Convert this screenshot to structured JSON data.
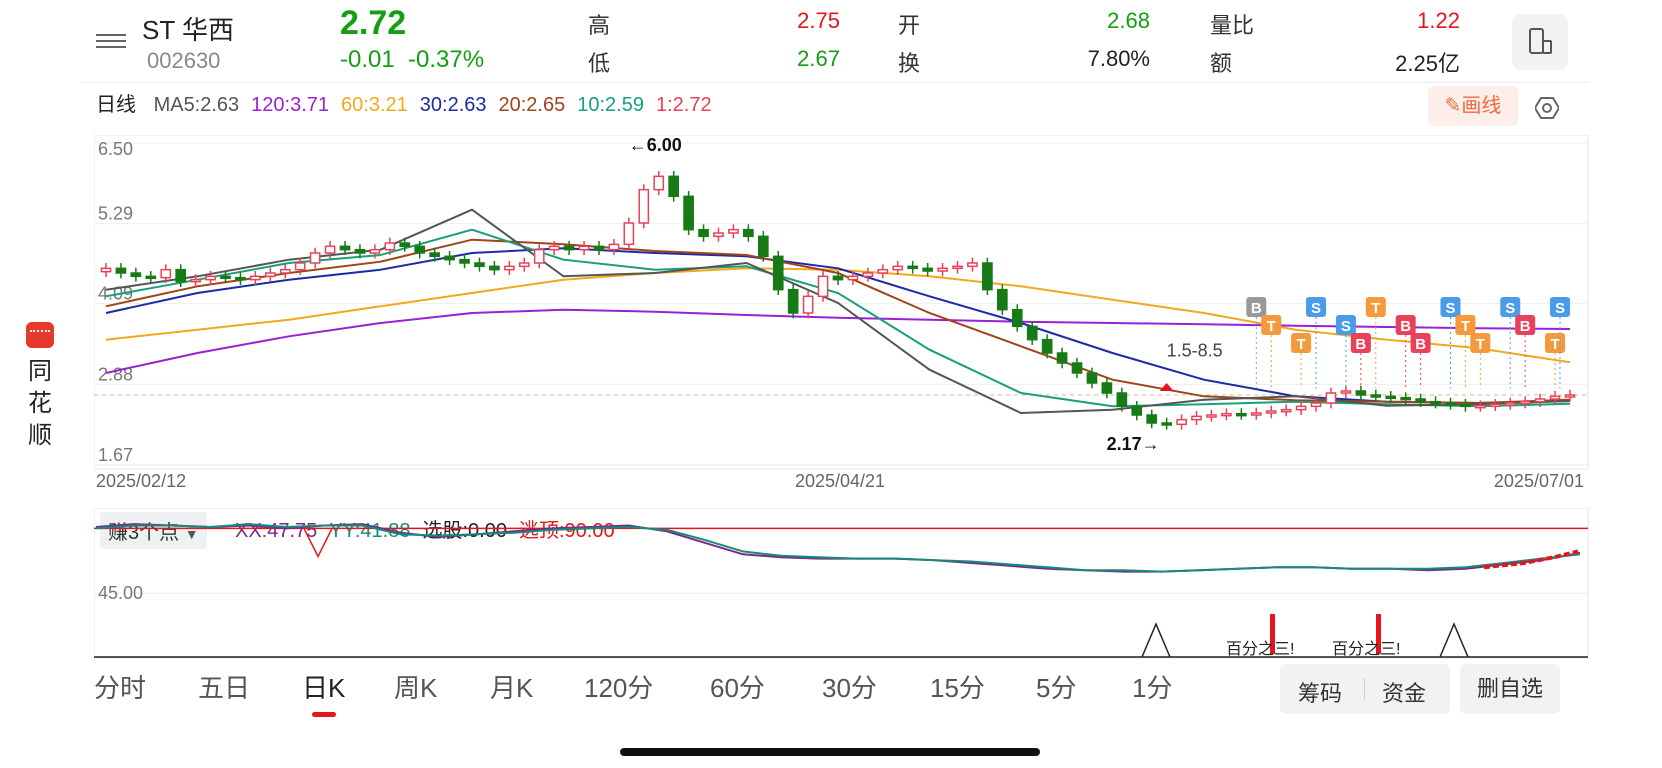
{
  "brand": {
    "name_chars": [
      "同",
      "花",
      "顺"
    ]
  },
  "quote": {
    "name": "ST 华西",
    "code": "002630",
    "price": "2.72",
    "change": "-0.01",
    "change_pct": "-0.37%",
    "stats": [
      {
        "label": "高",
        "value": "2.75",
        "color": "#e8141b"
      },
      {
        "label": "低",
        "value": "2.67",
        "color": "#12a012"
      },
      {
        "label": "开",
        "value": "2.68",
        "color": "#12a012"
      },
      {
        "label": "换",
        "value": "7.80%",
        "color": "#222222"
      },
      {
        "label": "量比",
        "value": "1.22",
        "color": "#e8141b"
      },
      {
        "label": "额",
        "value": "2.25亿",
        "color": "#222222"
      }
    ]
  },
  "ma_bar": {
    "period": "日线",
    "items": [
      {
        "text": "MA5:2.63",
        "color": "#555555"
      },
      {
        "text": "120:3.71",
        "color": "#9b1fd8"
      },
      {
        "text": "60:3.21",
        "color": "#f2a81d"
      },
      {
        "text": "30:2.63",
        "color": "#1c2aa6"
      },
      {
        "text": "20:2.65",
        "color": "#a0441a"
      },
      {
        "text": "10:2.59",
        "color": "#17a07a"
      },
      {
        "text": "1:2.72",
        "color": "#e8415a"
      }
    ],
    "draw_button": "画线"
  },
  "chart_data": {
    "type": "candlestick",
    "y_ticks": [
      "6.50",
      "5.29",
      "4.09",
      "2.88",
      "1.67"
    ],
    "ylim": [
      1.67,
      6.5
    ],
    "x_ticks": [
      "2025/02/12",
      "2025/04/21",
      "2025/07/01"
    ],
    "annotations": {
      "high": "←6.00",
      "low": "2.17→",
      "range": "1.5-8.5"
    },
    "close_approx": [
      4.62,
      4.55,
      4.5,
      4.48,
      4.6,
      4.42,
      4.45,
      4.5,
      4.48,
      4.45,
      4.5,
      4.55,
      4.6,
      4.7,
      4.85,
      4.95,
      4.9,
      4.85,
      4.9,
      5.0,
      4.95,
      4.85,
      4.8,
      4.75,
      4.7,
      4.65,
      4.6,
      4.65,
      4.7,
      4.9,
      4.95,
      4.9,
      4.95,
      4.9,
      4.98,
      5.3,
      5.8,
      6.0,
      5.7,
      5.2,
      5.1,
      5.15,
      5.2,
      5.1,
      4.8,
      4.3,
      3.95,
      4.2,
      4.5,
      4.45,
      4.5,
      4.55,
      4.6,
      4.65,
      4.62,
      4.58,
      4.62,
      4.65,
      4.7,
      4.3,
      4.0,
      3.75,
      3.55,
      3.35,
      3.2,
      3.05,
      2.9,
      2.75,
      2.55,
      2.42,
      2.3,
      2.28,
      2.35,
      2.4,
      2.42,
      2.44,
      2.43,
      2.45,
      2.48,
      2.5,
      2.55,
      2.6,
      2.75,
      2.78,
      2.72,
      2.7,
      2.68,
      2.66,
      2.62,
      2.6,
      2.58,
      2.55,
      2.56,
      2.58,
      2.6,
      2.62,
      2.66,
      2.7,
      2.72
    ],
    "ma_series": [
      {
        "name": "120",
        "color": "#9b1fd8",
        "values": [
          3.05,
          3.35,
          3.6,
          3.8,
          3.95,
          4.0,
          3.97,
          3.92,
          3.88,
          3.85,
          3.82,
          3.8,
          3.78,
          3.76,
          3.74,
          3.72,
          3.71
        ]
      },
      {
        "name": "60",
        "color": "#f2a81d",
        "values": [
          3.55,
          3.7,
          3.85,
          4.05,
          4.25,
          4.45,
          4.55,
          4.62,
          4.6,
          4.5,
          4.35,
          4.15,
          3.95,
          3.7,
          3.55,
          3.42,
          3.21
        ]
      },
      {
        "name": "30",
        "color": "#1c2aa6",
        "values": [
          3.95,
          4.25,
          4.45,
          4.6,
          4.85,
          4.92,
          4.85,
          4.8,
          4.62,
          4.2,
          3.8,
          3.35,
          2.95,
          2.7,
          2.62,
          2.6,
          2.63
        ]
      },
      {
        "name": "20",
        "color": "#a0441a",
        "values": [
          4.05,
          4.35,
          4.55,
          4.72,
          5.05,
          4.98,
          4.88,
          4.82,
          4.55,
          3.95,
          3.45,
          2.95,
          2.7,
          2.64,
          2.62,
          2.6,
          2.65
        ]
      },
      {
        "name": "10",
        "color": "#17a07a",
        "values": [
          4.2,
          4.45,
          4.7,
          4.82,
          5.2,
          4.75,
          4.6,
          4.65,
          4.25,
          3.4,
          2.75,
          2.55,
          2.58,
          2.62,
          2.58,
          2.55,
          2.59
        ]
      },
      {
        "name": "MA5",
        "color": "#555555",
        "values": [
          4.3,
          4.5,
          4.75,
          4.9,
          5.5,
          4.5,
          4.55,
          4.7,
          4.1,
          3.1,
          2.45,
          2.5,
          2.65,
          2.7,
          2.56,
          2.58,
          2.63
        ]
      }
    ],
    "signals": [
      {
        "label": "B",
        "color": "#999999"
      },
      {
        "label": "T",
        "color": "#f39a3c"
      },
      {
        "label": "T",
        "color": "#f39a3c"
      },
      {
        "label": "S",
        "color": "#4a9be8"
      },
      {
        "label": "S",
        "color": "#4a9be8"
      },
      {
        "label": "B",
        "color": "#e8415a"
      },
      {
        "label": "T",
        "color": "#f39a3c"
      },
      {
        "label": "B",
        "color": "#e8415a"
      },
      {
        "label": "B",
        "color": "#e8415a"
      },
      {
        "label": "S",
        "color": "#4a9be8"
      },
      {
        "label": "T",
        "color": "#f39a3c"
      },
      {
        "label": "T",
        "color": "#f39a3c"
      },
      {
        "label": "S",
        "color": "#4a9be8"
      },
      {
        "label": "B",
        "color": "#e8415a"
      },
      {
        "label": "T",
        "color": "#f39a3c"
      },
      {
        "label": "S",
        "color": "#4a9be8"
      }
    ]
  },
  "indicator": {
    "selector": "赚3个点",
    "items": [
      {
        "text": "XX:47.75",
        "color": "#7a2a84"
      },
      {
        "text": "YY:41.88",
        "color": "#17897a"
      },
      {
        "text": "选股:0.00",
        "color": "#222222"
      },
      {
        "text": "逃顶:90.00",
        "color": "#e8141b"
      }
    ],
    "level_label": "45.00",
    "marker_text": "百分之三!",
    "xx": [
      91,
      93,
      92,
      91,
      92,
      90,
      92,
      93,
      87,
      84,
      86,
      88,
      90,
      91,
      92,
      88,
      80,
      72,
      70,
      69,
      69,
      69,
      68,
      66,
      64,
      62,
      61,
      60,
      60,
      61,
      62,
      63,
      63,
      62,
      62,
      61,
      62,
      65,
      68,
      73
    ],
    "yy": [
      90,
      92,
      92,
      91,
      93,
      91,
      92,
      92,
      86,
      85,
      86,
      87,
      89,
      90,
      91,
      89,
      82,
      74,
      71,
      70,
      69,
      69,
      68,
      67,
      65,
      63,
      61,
      61,
      60,
      61,
      62,
      63,
      63,
      62,
      62,
      62,
      63,
      66,
      69,
      72
    ]
  },
  "periods": [
    "分时",
    "五日",
    "日K",
    "周K",
    "月K",
    "120分",
    "60分",
    "30分",
    "15分",
    "5分",
    "1分"
  ],
  "active_period": "日K",
  "actions": {
    "chips": "筹码",
    "funds": "资金",
    "remove": "删自选"
  }
}
